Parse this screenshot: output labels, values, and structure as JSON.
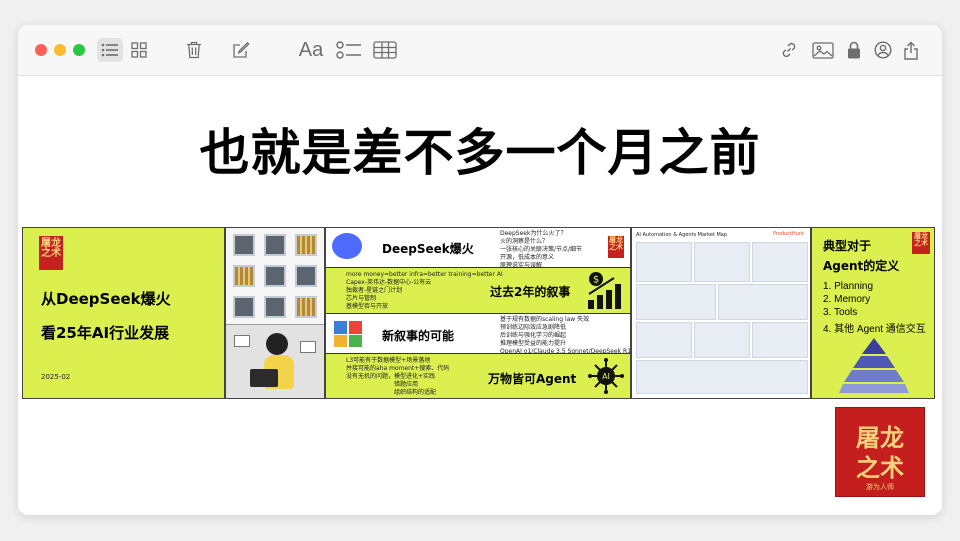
{
  "toolbar": {
    "colors": {
      "close": "#fe5f57",
      "minimize": "#febc2e",
      "zoom": "#28c840"
    },
    "left_icons": [
      "list-view-icon",
      "gallery-view-icon",
      "trash-icon",
      "compose-icon"
    ],
    "format_label": "Aa",
    "mid_icons": [
      "checklist-icon",
      "table-icon"
    ],
    "right_icons": [
      "link-icon",
      "image-icon",
      "lock-icon",
      "account-icon",
      "share-icon"
    ]
  },
  "note": {
    "title": "也就是差不多一个月之前",
    "strip": {
      "panel1": {
        "seal_text": "屠龙之术",
        "title_line1": "从DeepSeek爆火",
        "title_line2": "看25年AI行业发展",
        "date": "2025-02"
      },
      "panel3": {
        "deepseek_title": "DeepSeek爆火",
        "deepseek_bullets": [
          "DeepSeek为什么火了？",
          "火的洞察是什么？",
          "一张核心的关联决策/节点/细节",
          "开源，低成本的意义",
          "原理说实与误解"
        ],
        "narrative_bullets": [
          "more money=better infra=better training=better AI",
          "Capex-英伟达-数据中心-公有云",
          "独裁者-星链之门计划",
          "芯片与管制",
          "基模型否与开放"
        ],
        "narrative_title": "过去2年的叙事",
        "possible_title": "新叙事的可能",
        "possible_bullets": [
          "基于规有数据的scaling law 失效",
          "预训练边际效应急剧降低",
          "后训练与强化学习的崛起",
          "推理模型受益的能力提升",
          "OpenAI o1/Claude 3.5 Sonnet/DeepSeek R1"
        ],
        "agent_bullets": [
          "L3可能有于数据模型+场景落地",
          "并接可能的aha moment+搜索、代码",
          "没有无机的问题，模型进化+实践",
          "错题应用",
          "组织结构的适配"
        ],
        "agent_title": "万物皆可Agent",
        "seal_text": "屠龙之术"
      },
      "panel4": {
        "title": "AI Automation & Agents Market Map",
        "brand": "ProductHunt"
      },
      "panel5": {
        "heading_line1": "典型对于",
        "heading_line2": "Agent的定义",
        "items": [
          "1. Planning",
          "2. Memory",
          "3. Tools",
          "4. 其他 Agent 通信交互"
        ],
        "seal_text": "屠龙之术"
      }
    },
    "stamp": {
      "line1": "屠龙",
      "line2": "之术",
      "caption": "游为人师"
    }
  }
}
